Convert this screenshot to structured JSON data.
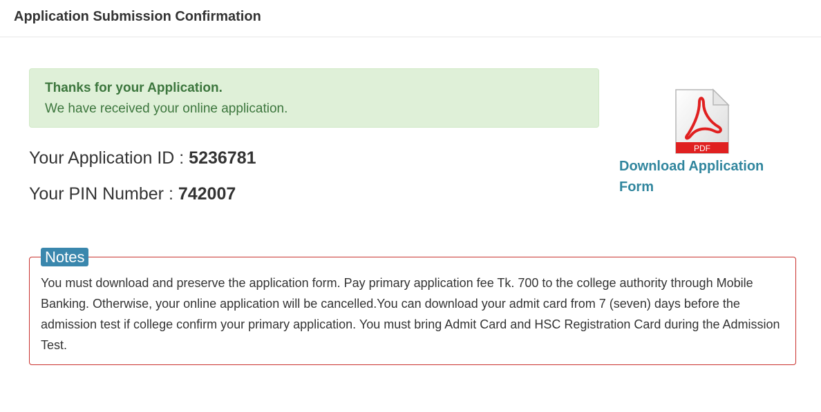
{
  "header": {
    "title": "Application Submission Confirmation"
  },
  "alert": {
    "title": "Thanks for your Application.",
    "message": "We have received your online application."
  },
  "application": {
    "id_label": "Your Application ID : ",
    "id_value": "5236781",
    "pin_label": "Your PIN Number : ",
    "pin_value": "742007"
  },
  "download": {
    "icon": "pdf-icon",
    "icon_text": "PDF",
    "label": "Download Application Form"
  },
  "notes": {
    "badge": "Notes",
    "text": "You must download and preserve the application form. Pay primary application fee Tk. 700 to the college authority through Mobile Banking. Otherwise, your online application will be cancelled.You can download your admit card from 7 (seven) days before the admission test if college confirm your primary application. You must bring Admit Card and HSC Registration Card during the Admission Test."
  },
  "colors": {
    "alert_bg": "#dff0d8",
    "alert_text": "#3c763d",
    "link": "#31869e",
    "notes_border": "#c9302c",
    "badge_bg": "#3a87ad"
  }
}
